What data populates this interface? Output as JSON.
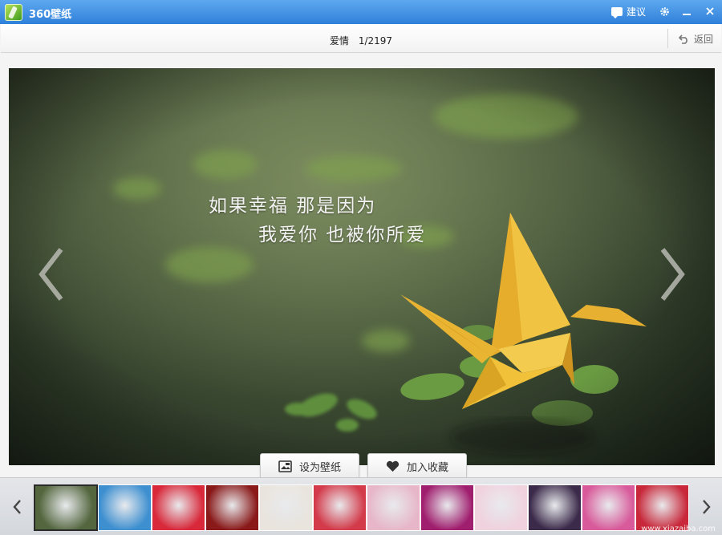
{
  "window": {
    "title": "360壁纸",
    "suggest_label": "建议",
    "settings_icon": "gear-icon",
    "minimize_icon": "minimize-icon",
    "close_icon": "close-icon"
  },
  "header": {
    "category": "爱情",
    "counter": "1/2197",
    "back_label": "返回"
  },
  "photo": {
    "line1": "如果幸福 那是因为",
    "line2": "我爱你 也被你所爱"
  },
  "actions": {
    "set_wallpaper": "设为壁纸",
    "add_favorite": "加入收藏"
  },
  "thumbnails": [
    {
      "theme": "paper-crane",
      "color": "#53663e",
      "active": true
    },
    {
      "theme": "dolphins",
      "color": "#3d8fd0"
    },
    {
      "theme": "red-pattern",
      "color": "#d8283a"
    },
    {
      "theme": "red-rose",
      "color": "#8a1a1a"
    },
    {
      "theme": "white-cake",
      "color": "#e9e4dd"
    },
    {
      "theme": "red-cupcakes",
      "color": "#d33a4a"
    },
    {
      "theme": "couple-pink",
      "color": "#e7b7c9"
    },
    {
      "theme": "purple-heart",
      "color": "#a01e6e"
    },
    {
      "theme": "pink-hearts",
      "color": "#f0d2df"
    },
    {
      "theme": "anime-couple",
      "color": "#3b2a4a"
    },
    {
      "theme": "teddy-bears",
      "color": "#d85a9a"
    },
    {
      "theme": "heart-cake",
      "color": "#c8283a"
    }
  ],
  "watermark": "www.xiazaiba.com"
}
